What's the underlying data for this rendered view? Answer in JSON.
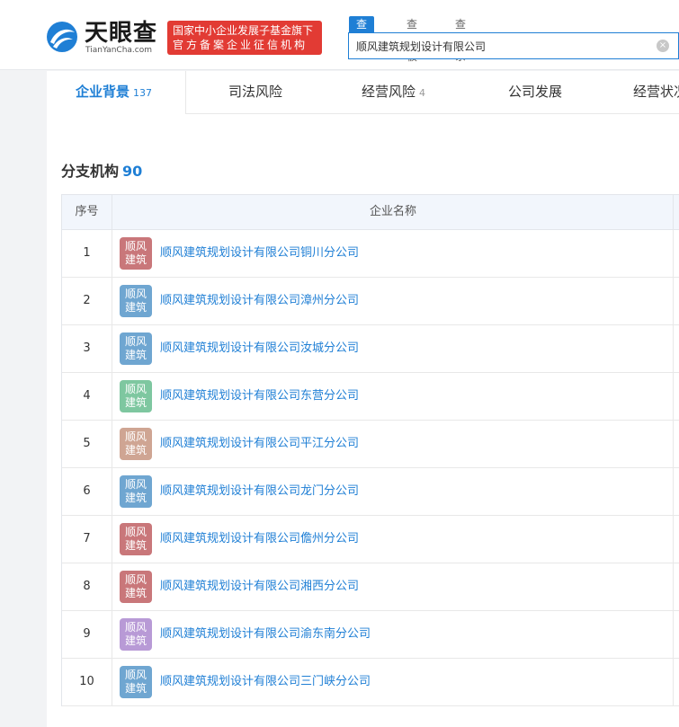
{
  "brand": {
    "name_cn": "天眼查",
    "name_en": "TianYanCha.com",
    "badge_line1": "国家中小企业发展子基金旗下",
    "badge_line2": "官方备案企业征信机构",
    "logo_color": "#1f7fd5",
    "badge_color": "#e23b34"
  },
  "search": {
    "tabs": [
      "查公司",
      "查老板",
      "查关系"
    ],
    "active_tab": 0,
    "value": "顺风建筑规划设计有限公司",
    "clear_icon": "×"
  },
  "nav": {
    "tabs": [
      {
        "label": "企业背景",
        "count": "137"
      },
      {
        "label": "司法风险",
        "count": ""
      },
      {
        "label": "经营风险",
        "count": "4"
      },
      {
        "label": "公司发展",
        "count": ""
      },
      {
        "label": "经营状况",
        "count": ""
      }
    ]
  },
  "section": {
    "title": "分支机构",
    "count": "90"
  },
  "table": {
    "headers": {
      "index": "序号",
      "name": "企业名称"
    },
    "rows": [
      {
        "index": "1",
        "logo_text": "顺风建筑",
        "logo_color": "#c9777a",
        "name": "顺风建筑规划设计有限公司铜川分公司"
      },
      {
        "index": "2",
        "logo_text": "顺风建筑",
        "logo_color": "#6fa6d1",
        "name": "顺风建筑规划设计有限公司漳州分公司"
      },
      {
        "index": "3",
        "logo_text": "顺风建筑",
        "logo_color": "#6fa6d1",
        "name": "顺风建筑规划设计有限公司汝城分公司"
      },
      {
        "index": "4",
        "logo_text": "顺风建筑",
        "logo_color": "#7ec7a0",
        "name": "顺风建筑规划设计有限公司东营分公司"
      },
      {
        "index": "5",
        "logo_text": "顺风建筑",
        "logo_color": "#cfa593",
        "name": "顺风建筑规划设计有限公司平江分公司"
      },
      {
        "index": "6",
        "logo_text": "顺风建筑",
        "logo_color": "#6fa6d1",
        "name": "顺风建筑规划设计有限公司龙门分公司"
      },
      {
        "index": "7",
        "logo_text": "顺风建筑",
        "logo_color": "#c9777a",
        "name": "顺风建筑规划设计有限公司儋州分公司"
      },
      {
        "index": "8",
        "logo_text": "顺风建筑",
        "logo_color": "#c9777a",
        "name": "顺风建筑规划设计有限公司湘西分公司"
      },
      {
        "index": "9",
        "logo_text": "顺风建筑",
        "logo_color": "#b89ad6",
        "name": "顺风建筑规划设计有限公司渝东南分公司"
      },
      {
        "index": "10",
        "logo_text": "顺风建筑",
        "logo_color": "#6fa6d1",
        "name": "顺风建筑规划设计有限公司三门峡分公司"
      }
    ]
  }
}
